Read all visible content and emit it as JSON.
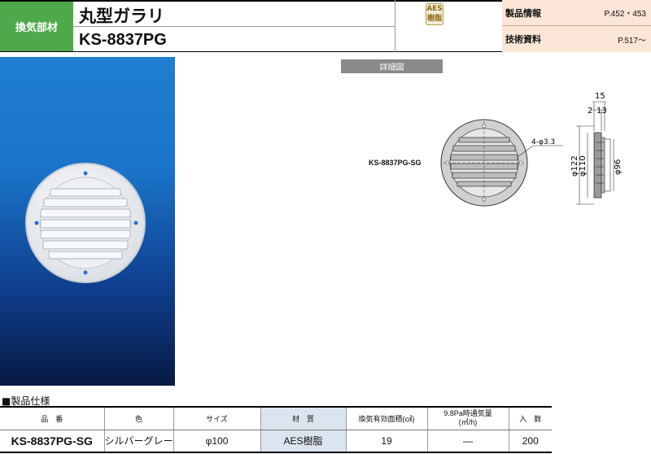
{
  "header": {
    "category": "換気部材",
    "title": "丸型ガラリ",
    "model": "KS-8837PG",
    "aes_badge": [
      "AES",
      "樹脂"
    ],
    "info": [
      {
        "label": "製品情報",
        "value": "P.452・453"
      },
      {
        "label": "技術資料",
        "value": "P.517～"
      }
    ]
  },
  "detail": {
    "tag": "詳細図",
    "model_label": "KS-8837PG-SG",
    "dims": {
      "holes": "4-φ3.3",
      "d122": "φ122",
      "d110": "φ110",
      "d96": "φ96",
      "t15": "15",
      "t2": "2",
      "t13": "13"
    }
  },
  "spec": {
    "title": "■製品仕様",
    "headers": [
      "品　番",
      "色",
      "サイズ",
      "材　質",
      "換気有効面積(㎠)",
      "9.8Pa時通気量\n(㎥/h)",
      "入　数"
    ],
    "row": [
      "KS-8837PG-SG",
      "シルバーグレー",
      "φ100",
      "AES樹脂",
      "19",
      "―",
      "200"
    ]
  },
  "colors": {
    "category_bg": "#4fa84a",
    "info_bg": "#fbe5d6",
    "header_shade": "#dbe4ef",
    "photo_bg_top": "#1f7fd0",
    "photo_bg_bottom": "#071a42"
  }
}
